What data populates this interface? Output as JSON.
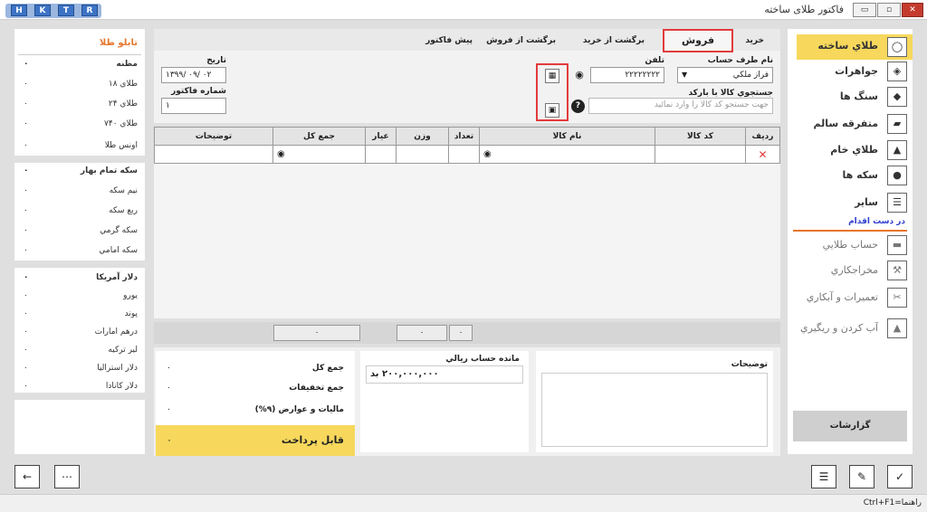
{
  "window": {
    "title": "فاکتور طلای ساخته",
    "lang_buttons": [
      "H",
      "K",
      "T",
      "R"
    ],
    "controls": [
      "▭",
      "▫",
      "✕"
    ]
  },
  "sidebar": {
    "items": [
      {
        "label": "طلاي ساخته",
        "icon": "ring-icon",
        "glyph": "◯",
        "active": true
      },
      {
        "label": "جواهرات",
        "icon": "jewel-icon",
        "glyph": "◈"
      },
      {
        "label": "سنگ ها",
        "icon": "stones-icon",
        "glyph": "◆"
      },
      {
        "label": "متفرقه سالم",
        "icon": "misc-icon",
        "glyph": "▰"
      },
      {
        "label": "طلاي خام",
        "icon": "raw-gold-icon",
        "glyph": "▲"
      },
      {
        "label": "سکه ها",
        "icon": "coins-icon",
        "glyph": "●"
      },
      {
        "label": "ساير",
        "icon": "other-icon",
        "glyph": "☰"
      }
    ],
    "section_title": "در دست اقدام",
    "pending_items": [
      {
        "label": "حساب طلايي",
        "icon": "wallet-icon",
        "glyph": "▬"
      },
      {
        "label": "مخراجکاري",
        "icon": "hammer-icon",
        "glyph": "⚒"
      },
      {
        "label": "تعميرات و آبکاري",
        "icon": "tools-icon",
        "glyph": "✂"
      },
      {
        "label": "آب کردن و ريگيري",
        "icon": "melt-icon",
        "glyph": "▲"
      }
    ],
    "reports_label": "گزارشات"
  },
  "tabs": {
    "items": [
      "خريد",
      "فروش",
      "برگشت از خريد",
      "برگشت از فروش",
      "پيش فاکتور"
    ],
    "active": "فروش"
  },
  "form": {
    "account_label": "نام طرف حساب",
    "account_value": "فراز ملکي",
    "phone_label": "تلفن",
    "phone_value": "۲۲۲۲۲۲۲۲",
    "search_label": "جستجوي کالا با بارکد",
    "search_placeholder": "جهت جستجو کد کالا را وارد نمائيد",
    "date_label": "تاريخ",
    "date_value": "۱۳۹۹/ ۰۹/ ۰۲",
    "invoice_label": "شماره فاکتور",
    "invoice_value": "۱"
  },
  "table": {
    "headers": [
      "رديف",
      "کد کالا",
      "نام کالا",
      "تعداد",
      "وزن",
      "عيار",
      "جمع کل",
      "توضيحات"
    ]
  },
  "totals_row": {
    "values": [
      "۰",
      "۰",
      "۰"
    ]
  },
  "summary": {
    "notes_label": "توضيحات",
    "balance_label": "مانده حساب ريالي",
    "balance_value": "۲۰۰,۰۰۰,۰۰۰ بد",
    "rows": [
      {
        "label": "جمع کل",
        "value": "۰"
      },
      {
        "label": "جمع تخفيفات",
        "value": "۰"
      },
      {
        "label": "ماليات و عوارض (۹%)",
        "value": "۰"
      }
    ],
    "payable_label": "قابل پرداخت",
    "payable_value": "۰"
  },
  "gold_board": {
    "title": "تابلو طلا",
    "groups": [
      {
        "items": [
          {
            "label": "مظنه",
            "value": "۰"
          },
          {
            "label": "طلاي ۱۸",
            "value": "۰"
          },
          {
            "label": "طلاي ۲۴",
            "value": "۰"
          },
          {
            "label": "طلاي ۷۴۰",
            "value": "۰"
          },
          {
            "label": "اونس طلا",
            "value": "۰"
          }
        ]
      },
      {
        "items": [
          {
            "label": "سکه تمام بهار",
            "value": "۰"
          },
          {
            "label": "نيم سکه",
            "value": "۰"
          },
          {
            "label": "ربع سکه",
            "value": "۰"
          },
          {
            "label": "سکه گرمي",
            "value": "۰"
          },
          {
            "label": "سکه امامي",
            "value": "۰"
          }
        ]
      },
      {
        "items": [
          {
            "label": "دلار آمريکا",
            "value": "۰"
          },
          {
            "label": "يورو",
            "value": "۰"
          },
          {
            "label": "پوند",
            "value": "۰"
          },
          {
            "label": "درهم امارات",
            "value": "۰"
          },
          {
            "label": "لير ترکيه",
            "value": "۰"
          },
          {
            "label": "دلار استراليا",
            "value": "۰"
          },
          {
            "label": "دلار کانادا",
            "value": "۰"
          }
        ]
      }
    ]
  },
  "status_bar": {
    "help": "راهنما=Ctrl+F1"
  },
  "colors": {
    "accent_yellow": "#f7d85c",
    "highlight_red": "#e33b3b",
    "title_orange": "#e8762b",
    "section_blue": "#2d3ecf"
  }
}
